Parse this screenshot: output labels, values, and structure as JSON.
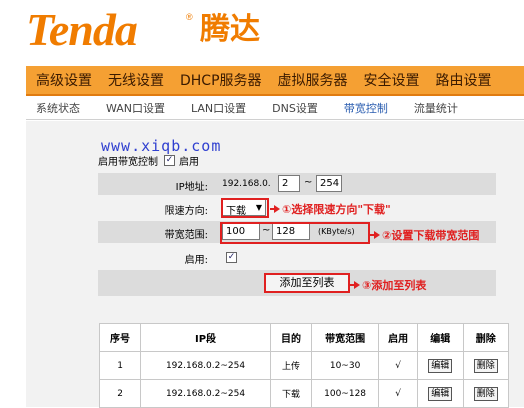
{
  "logo": {
    "brand": "Tenda",
    "reg": "®",
    "brand_cn": "腾达"
  },
  "main_nav": [
    "高级设置",
    "无线设置",
    "DHCP服务器",
    "虚拟服务器",
    "安全设置",
    "路由设置"
  ],
  "sub_nav": [
    "系统状态",
    "WAN口设置",
    "LAN口设置",
    "DNS设置",
    "带宽控制",
    "流量统计"
  ],
  "watermark": "www.xiqb.com",
  "enable_control": {
    "label": "启用带宽控制",
    "checkbox_text": "启用",
    "checked": true
  },
  "form": {
    "ip": {
      "label": "IP地址:",
      "prefix": "192.168.0.",
      "start": "2",
      "sep": "~",
      "end": "254"
    },
    "direction": {
      "label": "限速方向:",
      "value": "下载"
    },
    "range": {
      "label": "带宽范围:",
      "min": "100",
      "sep": "~",
      "max": "128",
      "unit": "(KByte/s)"
    },
    "enable": {
      "label": "启用:",
      "checked": true
    },
    "add_button": "添加至列表"
  },
  "annotations": {
    "a1": "①选择限速方向\"下载\"",
    "a2": "②设置下载带宽范围",
    "a3": "③添加至列表"
  },
  "table": {
    "headers": [
      "序号",
      "IP段",
      "目的",
      "带宽范围",
      "启用",
      "编辑",
      "删除"
    ],
    "rows": [
      {
        "no": "1",
        "ip": "192.168.0.2~254",
        "dir": "上传",
        "range": "10~30",
        "enabled": "√",
        "edit": "编辑",
        "del": "删除"
      },
      {
        "no": "2",
        "ip": "192.168.0.2~254",
        "dir": "下载",
        "range": "100~128",
        "enabled": "√",
        "edit": "编辑",
        "del": "删除"
      }
    ]
  },
  "colors": {
    "brand": "#f07c00",
    "nav_bg": "#f5a033",
    "annotation": "#e02020",
    "active_tab": "#2a5db0"
  }
}
